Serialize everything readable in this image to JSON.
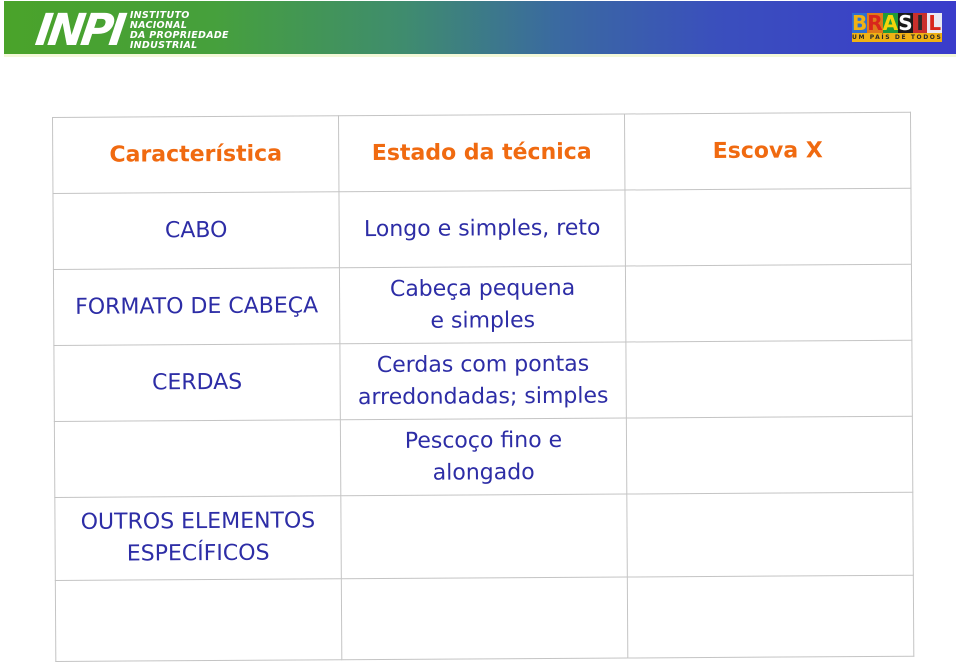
{
  "banner": {
    "logo_mark": "INPI",
    "logo_lines": [
      "INSTITUTO",
      "NACIONAL",
      "DA PROPRIEDADE",
      "INDUSTRIAL"
    ],
    "brasil_letters": [
      "B",
      "R",
      "A",
      "S",
      "I",
      "L"
    ],
    "brasil_tagline": "UM PAÍS DE TODOS"
  },
  "table": {
    "headers": [
      "Característica",
      "Estado da técnica",
      "Escova X"
    ],
    "rows": [
      [
        "CABO",
        "Longo e simples, reto",
        ""
      ],
      [
        "FORMATO DE CABEÇA",
        "Cabeça pequena e simples",
        ""
      ],
      [
        "CERDAS",
        "Cerdas com pontas arredondadas; simples",
        ""
      ],
      [
        "",
        "Pescoço fino e alongado",
        ""
      ],
      [
        "OUTROS ELEMENTOS ESPECÍFICOS",
        "",
        ""
      ],
      [
        "",
        "",
        ""
      ]
    ]
  },
  "colors": {
    "header_text": "#f06a10",
    "body_text": "#2d2da6",
    "banner_start": "#4aa32a",
    "banner_end": "#3a3ccb"
  }
}
